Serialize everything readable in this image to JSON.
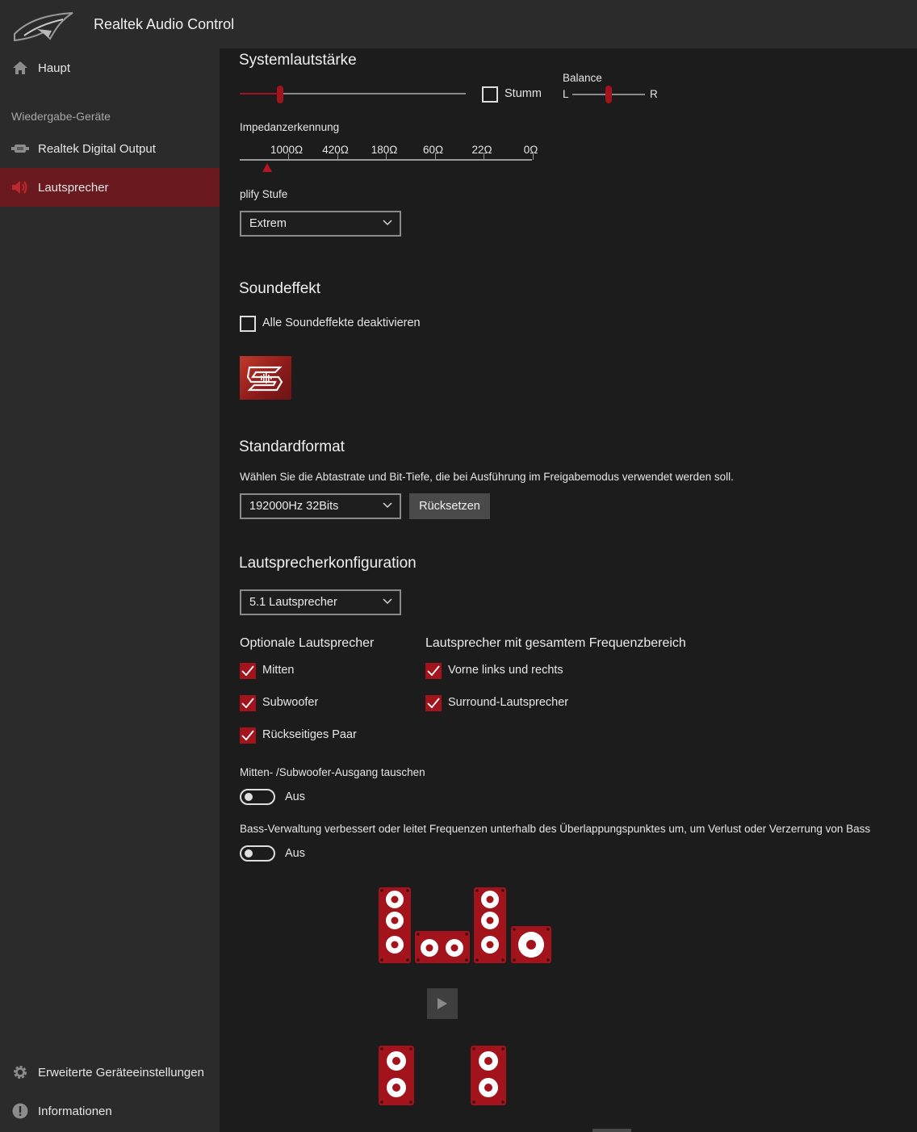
{
  "app": {
    "title": "Realtek Audio Control"
  },
  "sidebar": {
    "main_item": "Haupt",
    "section_label": "Wiedergabe-Geräte",
    "devices": [
      {
        "label": "Realtek Digital Output",
        "icon": "digital-output-icon",
        "active": false
      },
      {
        "label": "Lautsprecher",
        "icon": "speaker-icon",
        "active": true
      }
    ],
    "bottom_items": [
      {
        "label": "Erweiterte Geräteeinstellungen",
        "icon": "gear-icon"
      },
      {
        "label": "Informationen",
        "icon": "info-icon"
      }
    ]
  },
  "system_volume": {
    "title": "Systemlautstärke",
    "volume_level": 0.17,
    "mute_label": "Stumm",
    "mute_checked": false,
    "balance_label": "Balance",
    "balance_left": "L",
    "balance_right": "R",
    "balance_value": 0.5
  },
  "impedance": {
    "label": "Impedanzerkennung",
    "ticks": [
      "1000Ω",
      "420Ω",
      "180Ω",
      "60Ω",
      "22Ω",
      "0Ω"
    ],
    "marker_index": 0
  },
  "amplify": {
    "label": "plify Stufe",
    "selected": "Extrem"
  },
  "sound_effect": {
    "title": "Soundeffekt",
    "disable_all_label": "Alle Soundeffekte deaktivieren",
    "disable_all_checked": false
  },
  "default_format": {
    "title": "Standardformat",
    "description": "Wählen Sie die Abtastrate und Bit-Tiefe, die bei Ausführung im Freigabemodus verwendet werden soll.",
    "selected": "192000Hz 32Bits",
    "reset_label": "Rücksetzen"
  },
  "speaker_config": {
    "title": "Lautsprecherkonfiguration",
    "selected": "5.1 Lautsprecher",
    "optional_title": "Optionale Lautsprecher",
    "optional": [
      {
        "label": "Mitten",
        "checked": true
      },
      {
        "label": "Subwoofer",
        "checked": true
      },
      {
        "label": "Rückseitiges Paar",
        "checked": true
      }
    ],
    "fullrange_title": "Lautsprecher mit gesamtem Frequenzbereich",
    "fullrange": [
      {
        "label": "Vorne links und rechts",
        "checked": true
      },
      {
        "label": "Surround-Lautsprecher",
        "checked": true
      }
    ],
    "swap_label": "Mitten- /Subwoofer-Ausgang tauschen",
    "swap_state": "Aus",
    "bass_label": "Bass-Verwaltung verbessert oder leitet Frequenzen unterhalb des Überlappungspunktes um, um Verlust oder Verzerrung von Bass",
    "bass_state": "Aus"
  },
  "colors": {
    "accent": "#a3131c",
    "active_nav": "#6a1a1f",
    "sidebar_bg": "#2b2b2b",
    "main_bg": "#1c1c1c"
  }
}
